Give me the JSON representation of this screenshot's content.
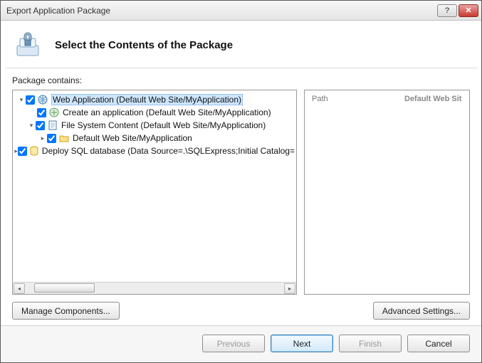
{
  "window": {
    "title": "Export Application Package"
  },
  "header": {
    "title": "Select the Contents of the Package"
  },
  "body_label": "Package contains:",
  "tree": {
    "n0": {
      "label": "Web Application (Default Web Site/MyApplication)",
      "checked": true,
      "expanded": true,
      "selected": true
    },
    "n1": {
      "label": "Create an application (Default Web Site/MyApplication)",
      "checked": true
    },
    "n2": {
      "label": "File System Content (Default Web Site/MyApplication)",
      "checked": true,
      "expanded": true
    },
    "n3": {
      "label": "Default Web Site/MyApplication",
      "checked": true,
      "expanded": false
    },
    "n4": {
      "label": "Deploy SQL database (Data Source=.\\SQLExpress;Initial Catalog=",
      "checked": true,
      "expanded": false
    }
  },
  "details": {
    "path_label": "Path",
    "path_value": "Default Web Site/MyApplication"
  },
  "buttons": {
    "manage": "Manage Components...",
    "advanced": "Advanced Settings...",
    "previous": "Previous",
    "next": "Next",
    "finish": "Finish",
    "cancel": "Cancel"
  },
  "glyphs": {
    "help": "?",
    "close": "✕"
  }
}
